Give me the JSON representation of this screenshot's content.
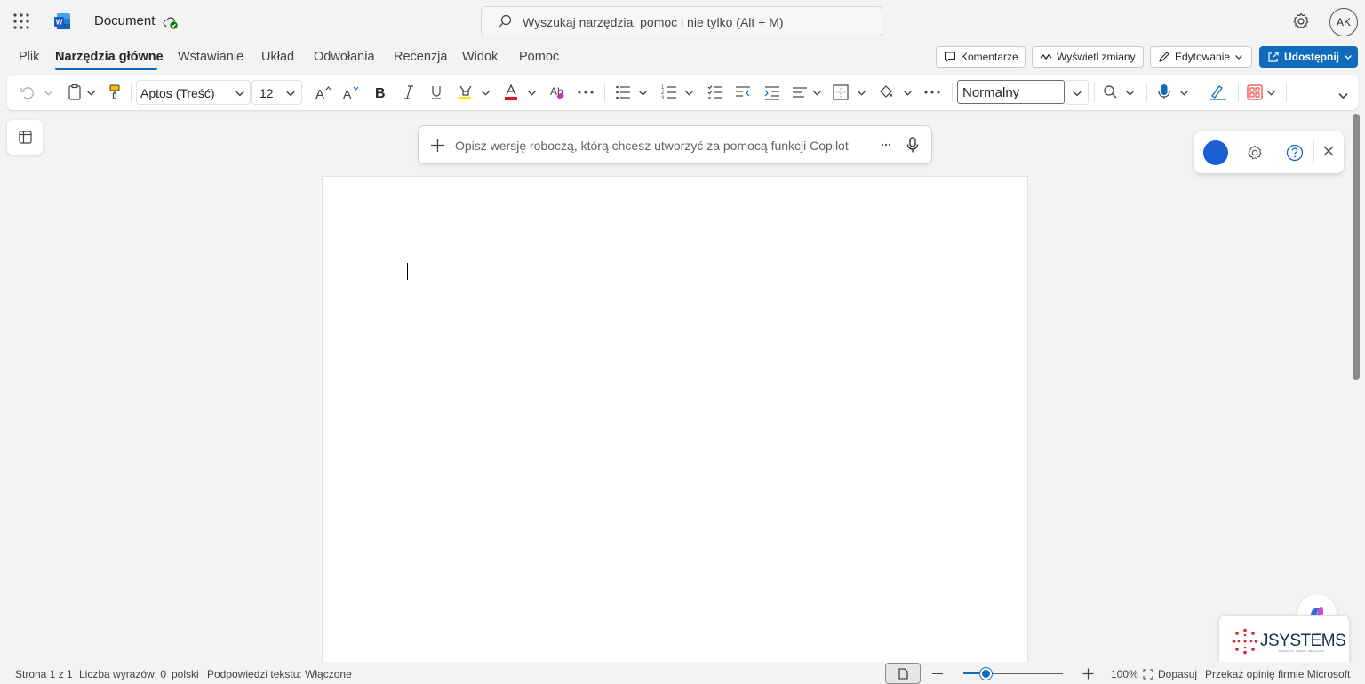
{
  "app": {
    "doc_title": "Document",
    "search_placeholder": "Wyszukaj narzędzia, pomoc i nie tylko (Alt + M)",
    "user_initials": "AK"
  },
  "tabs": [
    {
      "label": "Plik",
      "active": false
    },
    {
      "label": "Narzędzia główne",
      "active": true
    },
    {
      "label": "Wstawianie",
      "active": false
    },
    {
      "label": "Układ",
      "active": false
    },
    {
      "label": "Odwołania",
      "active": false
    },
    {
      "label": "Recenzja",
      "active": false
    },
    {
      "label": "Widok",
      "active": false
    },
    {
      "label": "Pomoc",
      "active": false
    }
  ],
  "ribbon_right": {
    "comments": "Komentarze",
    "track_changes": "Wyświetl zmiany",
    "editing": "Edytowanie",
    "share": "Udostępnij"
  },
  "ribbon": {
    "font_name": "Aptos (Treść)",
    "font_size": "12",
    "style_name": "Normalny"
  },
  "copilot": {
    "placeholder": "Opisz wersję roboczą, którą chcesz utworzyć za pomocą funkcji Copilot"
  },
  "status": {
    "page": "Strona 1 z 1",
    "word_count": "Liczba wyrazów: 0",
    "language": "polski",
    "text_predictions": "Podpowiedzi tekstu: Włączone",
    "zoom_percent": "100%",
    "zoom_value": 100,
    "fit": "Dopasuj",
    "feedback": "Przekaż opinię firmie Microsoft"
  },
  "branding": {
    "jsystems_name": "JSYSTEMS",
    "jsystems_tagline": "INSPIRACJA · WIEDZA · REALIZACJA"
  },
  "colors": {
    "accent": "#0f6cbd",
    "word_blue": "#185abd",
    "highlight_yellow": "#ffe600",
    "font_color_red": "#e81123"
  },
  "icons": [
    "app-launcher-icon",
    "word-logo-icon",
    "cloud-saved-icon",
    "search-icon",
    "settings-icon",
    "comment-icon",
    "track-changes-icon",
    "pencil-icon",
    "share-icon",
    "undo-icon",
    "clipboard-icon",
    "format-painter-icon",
    "grow-font-icon",
    "shrink-font-icon",
    "bold-icon",
    "italic-icon",
    "underline-icon",
    "highlight-icon",
    "font-color-icon",
    "clear-format-icon",
    "more-icon",
    "bullets-icon",
    "numbering-icon",
    "checklist-icon",
    "decrease-indent-icon",
    "increase-indent-icon",
    "align-icon",
    "borders-icon",
    "shading-icon",
    "find-icon",
    "dictate-icon",
    "editor-icon",
    "add-ins-icon",
    "collapse-ribbon-icon",
    "nav-pane-icon",
    "plus-icon",
    "microphone-icon",
    "help-icon",
    "close-icon"
  ]
}
